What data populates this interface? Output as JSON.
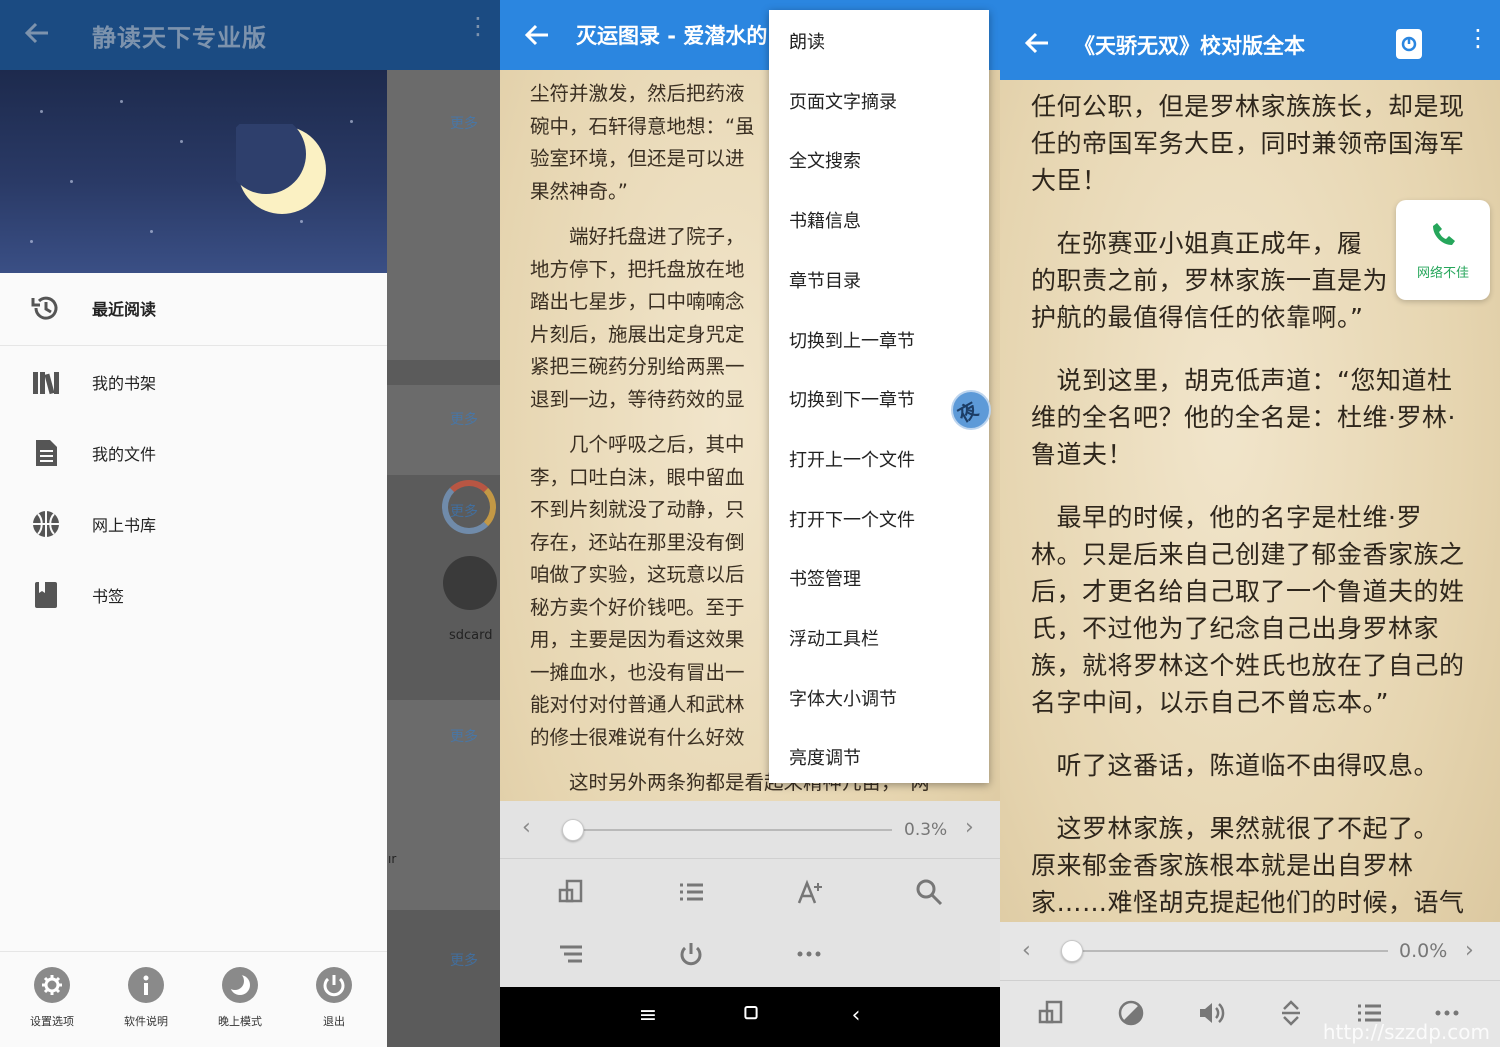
{
  "panel1": {
    "appbar_title": "静读天下专业版",
    "drawer_items": [
      {
        "label": "最近阅读",
        "icon": "history-icon",
        "active": true
      },
      {
        "label": "我的书架",
        "icon": "bookshelf-icon"
      },
      {
        "label": "我的文件",
        "icon": "file-icon"
      },
      {
        "label": "网上书库",
        "icon": "globe-icon"
      },
      {
        "label": "书签",
        "icon": "bookmark-icon"
      }
    ],
    "footer": [
      {
        "label": "设置选项",
        "icon": "gear-icon"
      },
      {
        "label": "软件说明",
        "icon": "info-icon"
      },
      {
        "label": "晚上模式",
        "icon": "moon-icon"
      },
      {
        "label": "退出",
        "icon": "power-icon"
      }
    ],
    "background_more": "更多",
    "background_sdcard": "sdcard",
    "background_fragment": "ır"
  },
  "panel2": {
    "title": "灭运图录 - 爱潜水的",
    "text_lines": [
      "尘符并激发，然后把药液",
      "碗中，石轩得意地想：“虽",
      "验室环境，但还是可以进",
      "果然神奇。”",
      "",
      "　　端好托盘进了院子，",
      "地方停下，把托盘放在地",
      "踏出七星步，口中喃喃念",
      "片刻后，施展出定身咒定",
      "紧把三碗药分别给两黑一",
      "退到一边，等待药效的显",
      "",
      "　　几个呼吸之后，其中",
      "李，口吐白沫，眼中留血",
      "不到片刻就没了动静，只",
      "存在，还站在那里没有倒",
      "咱做了实验，这玩意以后",
      "秘方卖个好价钱吧。至于",
      "用，主要是因为看这效果",
      "一摊血水，也没有冒出一",
      "能对付对付普通人和武林",
      "的修士很难说有什么好效",
      "",
      "　　这时另外两条狗都是看起来精神几亩，　两"
    ],
    "menu_items": [
      "朗读",
      "页面文字摘录",
      "全文搜索",
      "书籍信息",
      "章节目录",
      "切换到上一章节",
      "切换到下一章节",
      "打开上一个文件",
      "打开下一个文件",
      "书签管理",
      "浮动工具栏",
      "字体大小调节",
      "亮度调节"
    ],
    "float_button_char": "夜",
    "progress": "0.3%",
    "progress_fraction": 0.003,
    "toolbar": [
      "rotate-icon",
      "list-icon",
      "font-size-icon",
      "search-icon",
      "menu-lines-icon",
      "power-icon",
      "more-icon"
    ]
  },
  "panel3": {
    "title": "《天骄无双》校对版全本",
    "paragraphs": [
      [
        "任何公职，但是罗林家族族长，却是现",
        "任的帝国军务大臣，同时兼领帝国海军",
        "大臣！"
      ],
      [
        "　在弥赛亚小姐真正成年，履",
        "的职责之前，罗林家族一直是为",
        "护航的最值得信任的依靠啊。”"
      ],
      [
        "　说到这里，胡克低声道：“您知道杜",
        "维的全名吧？他的全名是：杜维·罗林·",
        "鲁道夫！"
      ],
      [
        "　最早的时候，他的名字是杜维·罗",
        "林。只是后来自己创建了郁金香家族之",
        "后，才更名给自己取了一个鲁道夫的姓",
        "氏，不过他为了纪念自己出身罗林家",
        "族，就将罗林这个姓氏也放在了自己的",
        "名字中间，以示自己不曾忘本。”"
      ],
      [
        "　听了这番话，陈道临不由得叹息。"
      ],
      [
        "　这罗林家族，果然就很了不起了。",
        "原来郁金香家族根本就是出自罗林",
        "家……难怪胡克提起他们的时候，语气"
      ]
    ],
    "phone_card_label": "网络不佳",
    "progress": "0.0%",
    "progress_fraction": 0.0,
    "toolbar": [
      "rotate-icon",
      "theme-icon",
      "volume-icon",
      "scroll-icon",
      "list-icon",
      "more-icon"
    ],
    "watermark": "http://szzdp.com"
  },
  "colors": {
    "appbar_blue": "#2b86e0",
    "appbar_dim": "#1b4b82",
    "paper": "#e8d9b8"
  }
}
